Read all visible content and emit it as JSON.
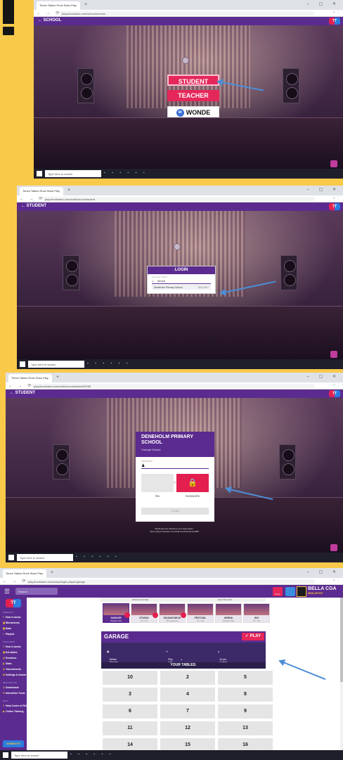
{
  "screens": [
    {
      "tab_title": "Times Tables Rock Stars Play",
      "url": "play.ttrockstars.com/school/choose",
      "header_label": "← SCHOOL",
      "app_logo_label": "TT",
      "buttons": [
        "STUDENT",
        "TEACHER",
        "WONDE"
      ],
      "taskbar_search_placeholder": "Type here to search"
    },
    {
      "tab_title": "Times Tables Rock Stars Play",
      "url": "play.ttrockstars.com/auth/school/student",
      "header_label": "← STUDENT",
      "app_logo_label": "TT",
      "login_title": "LOGIN",
      "search_label": "Find your school",
      "search_value": "deneh",
      "suggestion_name": "Deneholm Primary School",
      "suggestion_postcode": "DA11 8LT",
      "taskbar_search_placeholder": "Type here to search"
    },
    {
      "tab_title": "Times Tables Rock Stars Play",
      "url": "play.ttrockstars.com/auth/school/student/2085",
      "header_label": "← STUDENT",
      "app_logo_label": "TT",
      "school_name": "DENEHOLM PRIMARY SCHOOL",
      "change_school": "Change School",
      "username_label": "Username",
      "or_label": "or",
      "pin_label": "PIN",
      "password_label": "PASSWORD",
      "login_button": "LOGIN",
      "help_text": "Bookmark the following url to login faster:",
      "help_url": "https://play.ttrockstars.com/auth/school/student/2085",
      "taskbar_search_placeholder": "Type here to search"
    },
    {
      "tab_title": "Times Tables Rock Stars Play",
      "url": "play.ttrockstars.com/play/single-player/garage",
      "search_placeholder": "Search",
      "user_name": "BELLA CGA",
      "user_rank": "NEW ARTIST",
      "gift_label": "PLAY",
      "sidebar": {
        "logo": "TT",
        "sections": [
          {
            "label": "PARENTS",
            "items": [
              "How it works",
              "Worksheets",
              "Data",
              "Playlist"
            ]
          },
          {
            "label": "TEACHERS",
            "items": [
              "How it works",
              "Set tables",
              "Sessions",
              "Stats",
              "Tournaments",
              "Settings & Admin"
            ]
          },
          {
            "label": "RESOURCES",
            "items": [
              "Downloads",
              "Interactive Tools"
            ]
          },
          {
            "label": "HELP",
            "items": [
              "Help Centre & FAQs",
              "Online Training"
            ]
          }
        ],
        "bottom_badge": "NUMBOTS"
      },
      "modes": [
        "SINGLE PLAYER",
        "MULTIPLAYER"
      ],
      "venues": [
        {
          "name": "GARAGE",
          "sub": "Teacher Set"
        },
        {
          "name": "STUDIO",
          "sub": "12 × 12"
        },
        {
          "name": "SOUNDCHECK",
          "sub": "25 questions"
        },
        {
          "name": "FESTIVAL",
          "sub": "12 × 12"
        },
        {
          "name": "ARENA",
          "sub": "Teacher Set"
        },
        {
          "name": "GIG",
          "sub": "12 × 12"
        }
      ],
      "section_title": "GARAGE",
      "play_button": "PLAY",
      "options": [
        "Tables: Teacher Set",
        "Play solo",
        "10 per correct answer"
      ],
      "your_tables_label": "YOUR TABLES:",
      "tables": [
        "10",
        "2",
        "5",
        "3",
        "4",
        "8",
        "6",
        "7",
        "9",
        "11",
        "12",
        "13",
        "14",
        "15",
        "16"
      ],
      "taskbar_search_placeholder": "Type here to search"
    }
  ],
  "colors": {
    "page_background": "#f9c94a",
    "app_purple": "#5b2b8f",
    "accent_red": "#e5275a",
    "arrow_blue": "#4d8dd6"
  }
}
